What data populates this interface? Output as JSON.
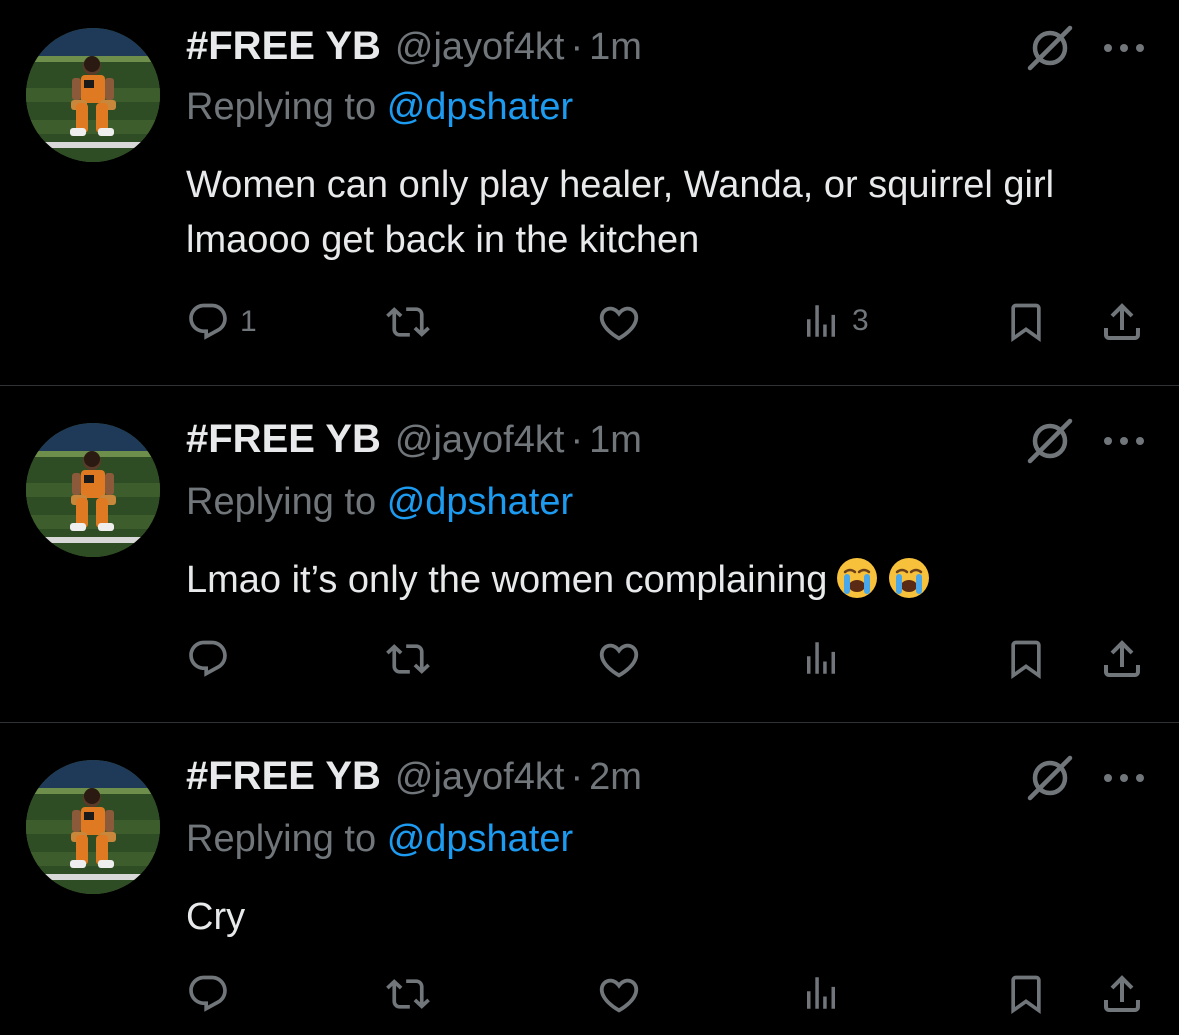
{
  "tweets": [
    {
      "display_name": "#FREE YB",
      "handle": "@jayof4kt",
      "separator": "·",
      "time": "1m",
      "replying_prefix": "Replying to",
      "replying_to": "@dpshater",
      "text": "Women can only play healer, Wanda, or squirrel girl lmaooo get back in the kitchen",
      "reply_count": "1",
      "view_count": "3"
    },
    {
      "display_name": "#FREE YB",
      "handle": "@jayof4kt",
      "separator": "·",
      "time": "1m",
      "replying_prefix": "Replying to",
      "replying_to": "@dpshater",
      "text": "Lmao it’s only the women complaining",
      "emojis": [
        "loudly-crying-face",
        "loudly-crying-face"
      ]
    },
    {
      "display_name": "#FREE YB",
      "handle": "@jayof4kt",
      "separator": "·",
      "time": "2m",
      "replying_prefix": "Replying to",
      "replying_to": "@dpshater",
      "text": "Cry"
    }
  ],
  "icons": {
    "reply": "reply-icon",
    "retweet": "retweet-icon",
    "like": "heart-icon",
    "views": "views-chart-icon",
    "bookmark": "bookmark-icon",
    "share": "share-icon",
    "grok": "grok-icon",
    "more": "more-icon"
  },
  "colors": {
    "background": "#000000",
    "text": "#e7e9ea",
    "secondary": "#71767b",
    "link": "#1d9bf0",
    "divider": "#2f3336"
  }
}
